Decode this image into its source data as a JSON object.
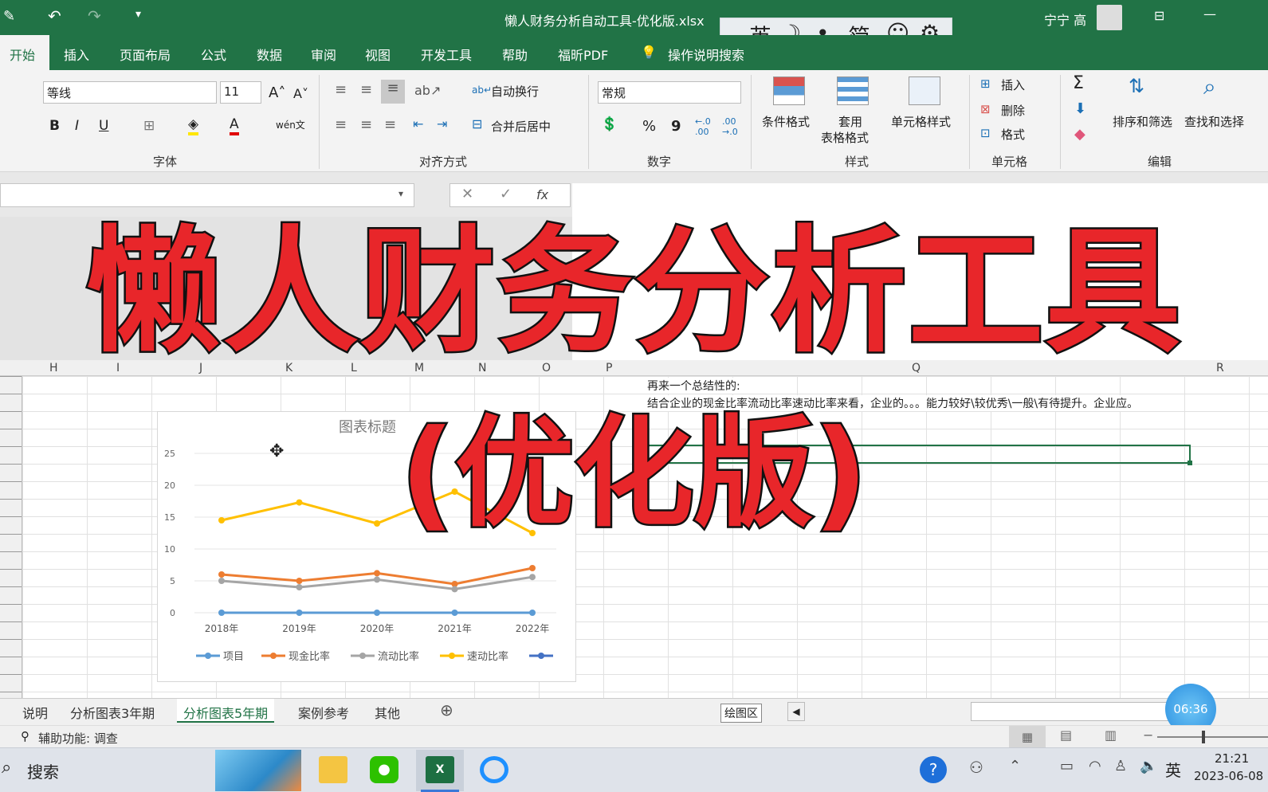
{
  "window": {
    "title": "懒人财务分析自动工具-优化版.xlsx",
    "user": "宁宁 高"
  },
  "ime": {
    "lang": "英",
    "moon": "☽",
    "dots": "•,",
    "simp": "简",
    "smile": "☺",
    "gear": "⚙"
  },
  "tabs": [
    "开始",
    "插入",
    "页面布局",
    "公式",
    "数据",
    "审阅",
    "视图",
    "开发工具",
    "帮助",
    "福昕PDF",
    "操作说明搜索"
  ],
  "ribbon": {
    "font_name": "等线",
    "font_size": "11",
    "bold": "B",
    "italic": "I",
    "underline": "U",
    "wrap": "自动换行",
    "merge": "合并后居中",
    "number_format": "常规",
    "percent": "%",
    "comma": "9",
    "cond": "条件格式",
    "table_fmt_1": "套用",
    "table_fmt_2": "表格格式",
    "cell_style": "单元格样式",
    "insert": "插入",
    "delete": "删除",
    "format": "格式",
    "sum": "Σ",
    "sort": "排序和筛选",
    "find": "查找和选择",
    "groups": {
      "font": "字体",
      "align": "对齐方式",
      "number": "数字",
      "styles": "样式",
      "cells": "单元格",
      "edit": "编辑"
    }
  },
  "formula": {
    "fx": "fx"
  },
  "overlay": {
    "title": "懒人财务分析工具",
    "subtitle": "(优化版)"
  },
  "columns": [
    "H",
    "I",
    "J",
    "K",
    "L",
    "M",
    "N",
    "O",
    "P",
    "Q",
    "R"
  ],
  "cells": {
    "line1": "再来一个总结性的:",
    "line2": "结合企业的现金比率流动比率速动比率来看，企业的。。。能力较好\\较优秀\\一般\\有待提升。企业应。"
  },
  "chart_data": {
    "type": "line",
    "title": "图表标题",
    "categories": [
      "2018年",
      "2019年",
      "2020年",
      "2021年",
      "2022年"
    ],
    "ylim": [
      0,
      25
    ],
    "yticks": [
      "0",
      "5",
      "10",
      "15",
      "20",
      "25"
    ],
    "series": [
      {
        "name": "项目",
        "color": "#5b9bd5",
        "values": [
          0,
          0,
          0,
          0,
          0
        ]
      },
      {
        "name": "现金比率",
        "color": "#ed7d31",
        "values": [
          6,
          5,
          6.2,
          4.5,
          7
        ]
      },
      {
        "name": "流动比率",
        "color": "#a5a5a5",
        "values": [
          5,
          4,
          5.2,
          3.7,
          5.6
        ]
      },
      {
        "name": "速动比率",
        "color": "#ffc000",
        "values": [
          14.5,
          17.3,
          14,
          19,
          12.5
        ]
      },
      {
        "name": "",
        "color": "#4472c4",
        "values": []
      }
    ]
  },
  "sheettabs": [
    "说明",
    "分析图表3年期",
    "分析图表5年期",
    "案例参考",
    "其他"
  ],
  "tooltip": "绘图区",
  "timer": "06:36",
  "status": {
    "access": "辅助功能: 调查"
  },
  "taskbar": {
    "search": "搜索",
    "lang": "英",
    "time": "21:21",
    "date": "2023-06-08"
  }
}
